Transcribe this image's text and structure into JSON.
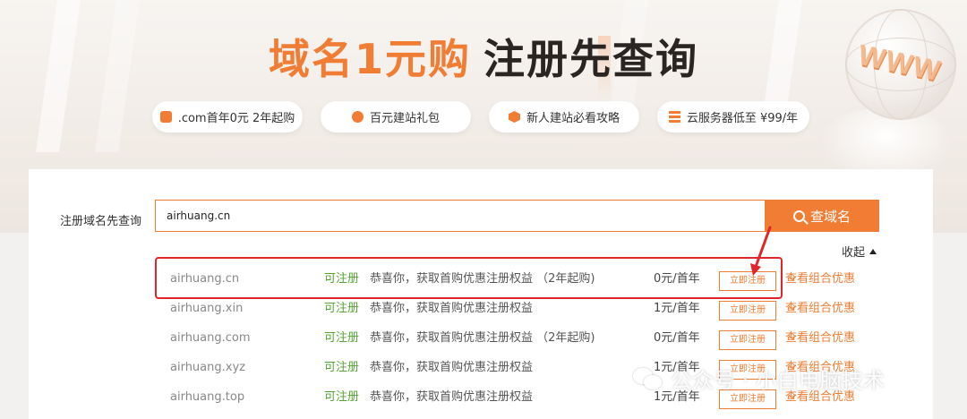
{
  "hero": {
    "title_highlight": "域名1元购",
    "title_main": "注册先查询",
    "decor_text": "WWW",
    "pills": [
      {
        "label": ".com首年0元 2年起购",
        "icon": "domain-tag-icon"
      },
      {
        "label": "百元建站礼包",
        "icon": "globe-icon"
      },
      {
        "label": "新人建站必看攻略",
        "icon": "shield-icon"
      },
      {
        "label": "云服务器低至 ¥99/年",
        "icon": "server-icon"
      }
    ]
  },
  "search": {
    "label": "注册域名先查询",
    "value": "airhuang.cn",
    "button_label": "查域名"
  },
  "results": {
    "collapse_label": "收起",
    "rows": [
      {
        "domain": "airhuang.cn",
        "status": "可注册",
        "message": "恭喜你，获取首购优惠注册权益 （2年起购)",
        "price": "0元/首年",
        "register": "立即注册",
        "combo": "查看组合优惠"
      },
      {
        "domain": "airhuang.xin",
        "status": "可注册",
        "message": "恭喜你，获取首购优惠注册权益",
        "price": "1元/首年",
        "register": "立即注册",
        "combo": "查看组合优惠"
      },
      {
        "domain": "airhuang.com",
        "status": "可注册",
        "message": "恭喜你，获取首购优惠注册权益 （2年起购)",
        "price": "0元/首年",
        "register": "立即注册",
        "combo": "查看组合优惠"
      },
      {
        "domain": "airhuang.xyz",
        "status": "可注册",
        "message": "恭喜你，获取首购优惠注册权益",
        "price": "1元/首年",
        "register": "立即注册",
        "combo": "查看组合优惠"
      },
      {
        "domain": "airhuang.top",
        "status": "可注册",
        "message": "恭喜你，获取首购优惠注册权益",
        "price": "1元/首年",
        "register": "立即注册",
        "combo": "查看组合优惠"
      }
    ]
  },
  "watermark": {
    "text": "公众号 · 小白电脑技术"
  },
  "colors": {
    "accent": "#f07d33",
    "available": "#55a532",
    "annotation": "#e0252b"
  }
}
